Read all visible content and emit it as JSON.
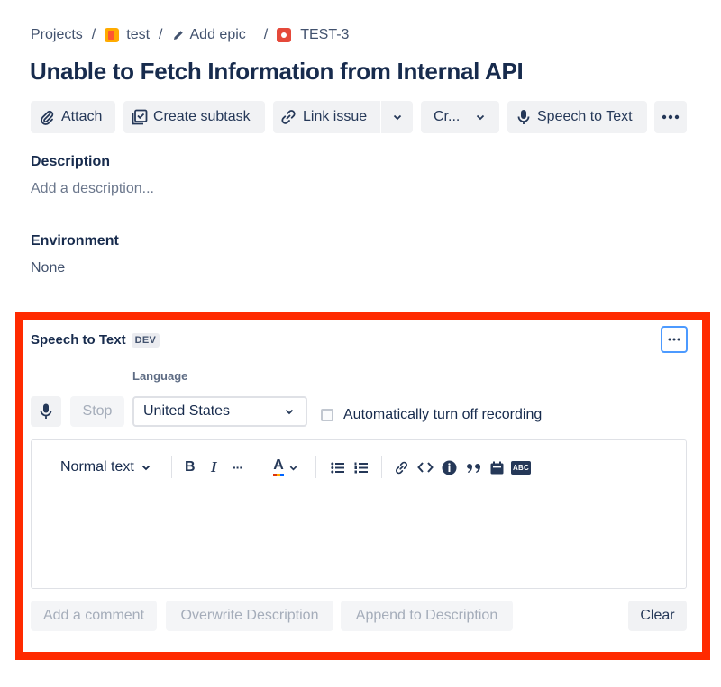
{
  "breadcrumb": {
    "projects": "Projects",
    "sep": "/",
    "project": "test",
    "epic": "Add epic",
    "issue_key": "TEST-3"
  },
  "issue": {
    "title": "Unable to Fetch Information from Internal API"
  },
  "toolbar": {
    "attach": "Attach",
    "create_subtask": "Create subtask",
    "link_issue": "Link issue",
    "cr": "Cr...",
    "speech_to_text": "Speech to Text"
  },
  "description": {
    "label": "Description",
    "placeholder": "Add a description..."
  },
  "environment": {
    "label": "Environment",
    "value": "None"
  },
  "speech_panel": {
    "title": "Speech to Text",
    "badge": "DEV",
    "language_label": "Language",
    "stop": "Stop",
    "language_value": "United States",
    "auto_off_label": "Automatically turn off recording",
    "auto_off_checked": false,
    "text_style": "Normal text",
    "bold": "B",
    "italic": "I",
    "ellipsis": "···",
    "font_color_glyph": "A",
    "abc": "ABC",
    "buttons": {
      "add_comment": "Add a comment",
      "overwrite": "Overwrite Description",
      "append": "Append to Description",
      "clear": "Clear"
    }
  },
  "colors": {
    "highlight_border": "#ff2a00",
    "focus_blue": "#4c9aff",
    "bug_red": "#e5493a",
    "project_orange": "#ffab00"
  }
}
